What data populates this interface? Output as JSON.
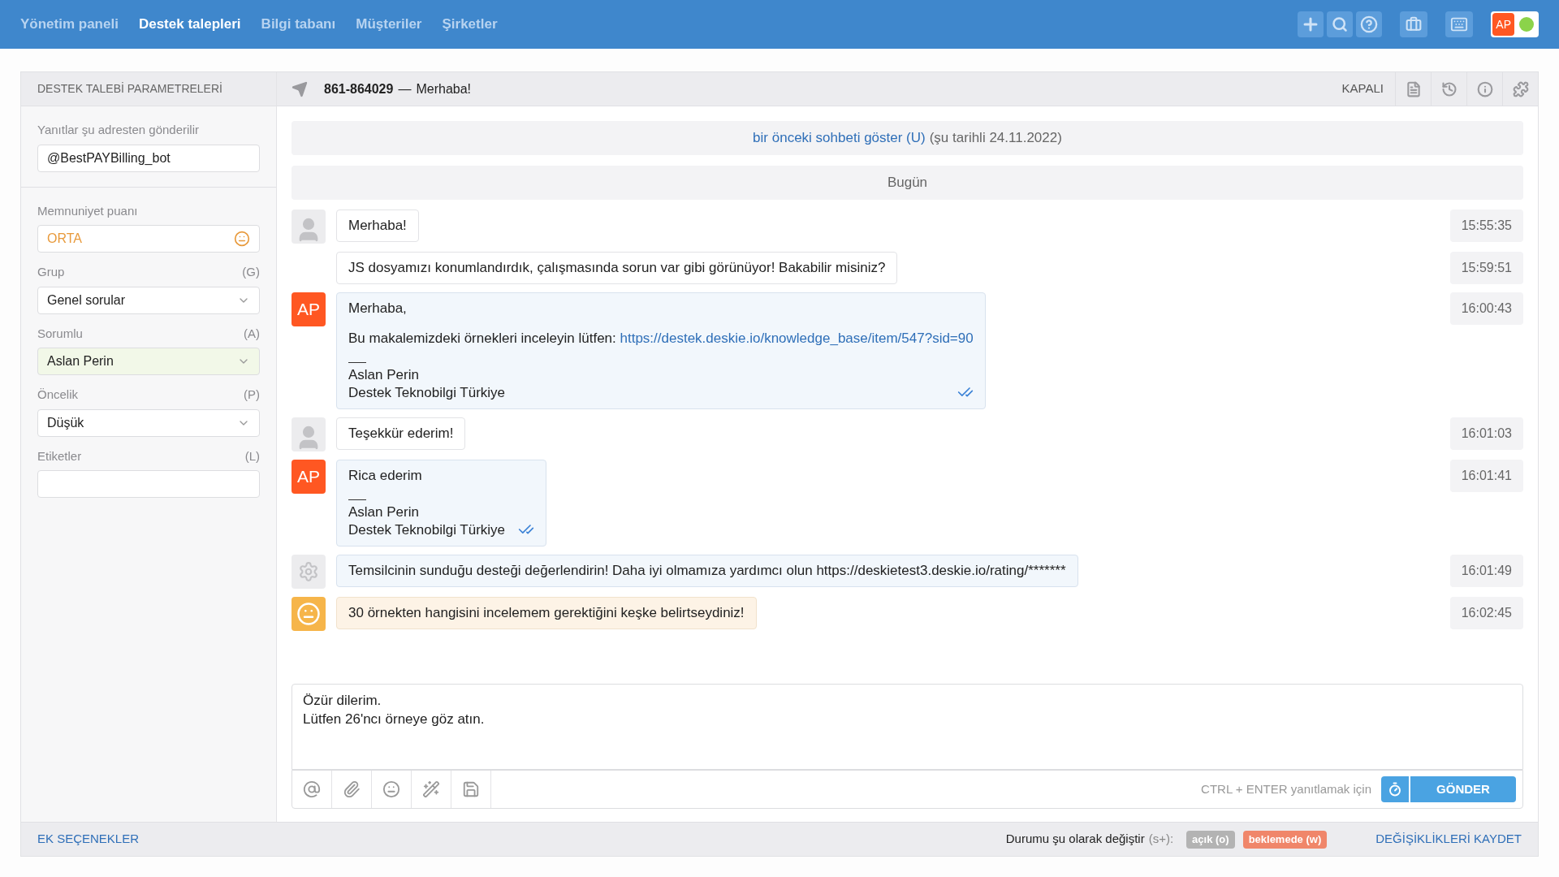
{
  "nav": {
    "items": [
      {
        "label": "Yönetim paneli",
        "selected": false
      },
      {
        "label": "Destek talepleri",
        "selected": true
      },
      {
        "label": "Bilgi tabanı",
        "selected": false
      },
      {
        "label": "Müşteriler",
        "selected": false
      },
      {
        "label": "Şirketler",
        "selected": false
      }
    ],
    "user": {
      "initials": "AP",
      "online": true
    }
  },
  "sidebar": {
    "title": "DESTEK TALEBİ PARAMETRELERİ",
    "reply_from": {
      "label": "Yanıtlar şu adresten gönderilir",
      "value": "@BestPAYBilling_bot"
    },
    "satisfaction": {
      "label": "Memnuniyet puanı",
      "value": "ORTA"
    },
    "fields": [
      {
        "label": "Grup",
        "hotkey": "(G)",
        "kind": "select",
        "value": "Genel sorular",
        "highlighted": false
      },
      {
        "label": "Sorumlu",
        "hotkey": "(A)",
        "kind": "select",
        "value": "Aslan Perin",
        "highlighted": true
      },
      {
        "label": "Öncelik",
        "hotkey": "(P)",
        "kind": "select",
        "value": "Düşük",
        "highlighted": false
      },
      {
        "label": "Etiketler",
        "hotkey": "(L)",
        "kind": "input"
      }
    ],
    "more_options": "EK SEÇENEKLER"
  },
  "ticket": {
    "number": "861-864029",
    "dash": "—",
    "subject": "Merhaba!",
    "status": "KAPALI"
  },
  "history_link": {
    "link": "bir önceki sohbeti göster (U)",
    "suffix": "(şu tarihli 24.11.2022)"
  },
  "day_divider": "Bugün",
  "messages": [
    {
      "kind": "client",
      "avatar": true,
      "paragraphs": [
        "Merhaba!"
      ],
      "time": "15:55:35"
    },
    {
      "kind": "client",
      "avatar": false,
      "paragraphs": [
        "JS dosyamızı konumlandırdık, çalışmasında sorun var gibi görünüyor! Bakabilir misiniz?"
      ],
      "time": "15:59:51"
    },
    {
      "kind": "agent",
      "avatar": true,
      "initials": "AP",
      "paragraphs": [
        "Merhaba,",
        "Bu makalemizdeki örnekleri inceleyin lütfen:"
      ],
      "link": "https://destek.deskie.io/knowledge_base/item/547?sid=90",
      "signature": [
        "Aslan Perin",
        "Destek Teknobilgi Türkiye"
      ],
      "read": true,
      "time": "16:00:43"
    },
    {
      "kind": "client",
      "avatar": true,
      "paragraphs": [
        "Teşekkür ederim!"
      ],
      "time": "16:01:03"
    },
    {
      "kind": "agent",
      "avatar": true,
      "initials": "AP",
      "paragraphs": [
        "Rica ederim"
      ],
      "signature": [
        "Aslan Perin",
        "Destek Teknobilgi Türkiye"
      ],
      "read": true,
      "time": "16:01:41"
    },
    {
      "kind": "system",
      "avatar": true,
      "paragraphs": [
        "Temsilcinin sunduğu desteği değerlendirin! Daha iyi olmamıza yardımcı olun https://deskietest3.deskie.io/rating/*******"
      ],
      "time": "16:01:49"
    },
    {
      "kind": "rating",
      "avatar": true,
      "paragraphs": [
        "30 örnekten hangisini incelemem gerektiğini keşke belirtseydiniz!"
      ],
      "time": "16:02:45"
    }
  ],
  "composer": {
    "value": "Özür dilerim.\nLütfen 26'ncı örneye göz atın.",
    "hint": "CTRL + ENTER yanıtlamak için",
    "send": "GÖNDER"
  },
  "footer": {
    "label": "Durumu şu olarak değiştir",
    "shortcut": "(s+):",
    "statuses": [
      {
        "label": "açık (o)",
        "color": "#b3b3b3"
      },
      {
        "label": "beklemede (w)",
        "color": "#f0866a"
      }
    ],
    "save": "DEĞİŞİKLİKLERİ KAYDET"
  }
}
